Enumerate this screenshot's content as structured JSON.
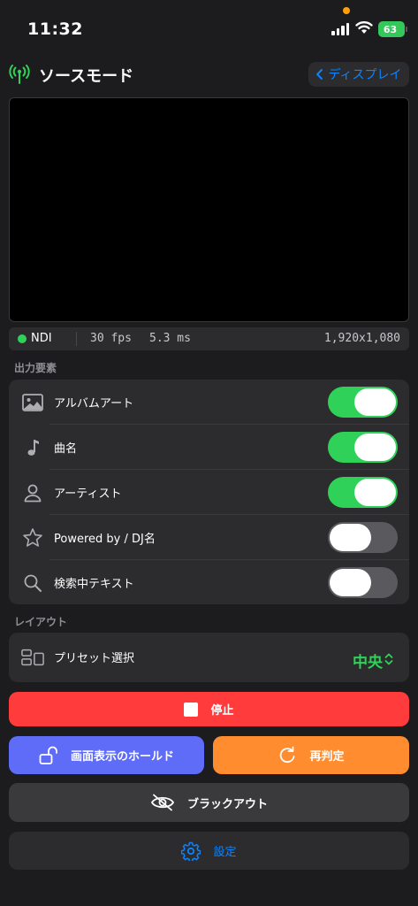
{
  "status_bar": {
    "time": "11:32",
    "battery": "63"
  },
  "header": {
    "title": "ソースモード",
    "back_label": "ディスプレイ",
    "antenna_icon": "antenna-icon"
  },
  "info_bar": {
    "source": "NDI",
    "fps": "30 fps",
    "latency": "5.3 ms",
    "resolution": "1,920x1,080"
  },
  "output_section": {
    "title": "出力要素",
    "items": [
      {
        "label": "アルバムアート",
        "icon": "photo-icon",
        "enabled": true
      },
      {
        "label": "曲名",
        "icon": "music-note-icon",
        "enabled": true
      },
      {
        "label": "アーティスト",
        "icon": "person-icon",
        "enabled": true
      },
      {
        "label": "Powered by / DJ名",
        "icon": "star-icon",
        "enabled": false
      },
      {
        "label": "検索中テキスト",
        "icon": "magnifier-icon",
        "enabled": false
      }
    ]
  },
  "layout_section": {
    "title": "レイアウト",
    "preset_label": "プリセット選択",
    "preset_value": "中央"
  },
  "buttons": {
    "stop": "停止",
    "hold": "画面表示のホールド",
    "rejudge": "再判定",
    "blackout": "ブラックアウト",
    "settings": "設定"
  },
  "colors": {
    "background": "#1c1c1e",
    "card": "#2c2c2e",
    "accent_green": "#30d158",
    "accent_blue": "#0a84ff",
    "stop_red": "#ff3b3b",
    "hold_purple": "#5e6cf7",
    "rejudge_orange": "#ff8c2e"
  }
}
